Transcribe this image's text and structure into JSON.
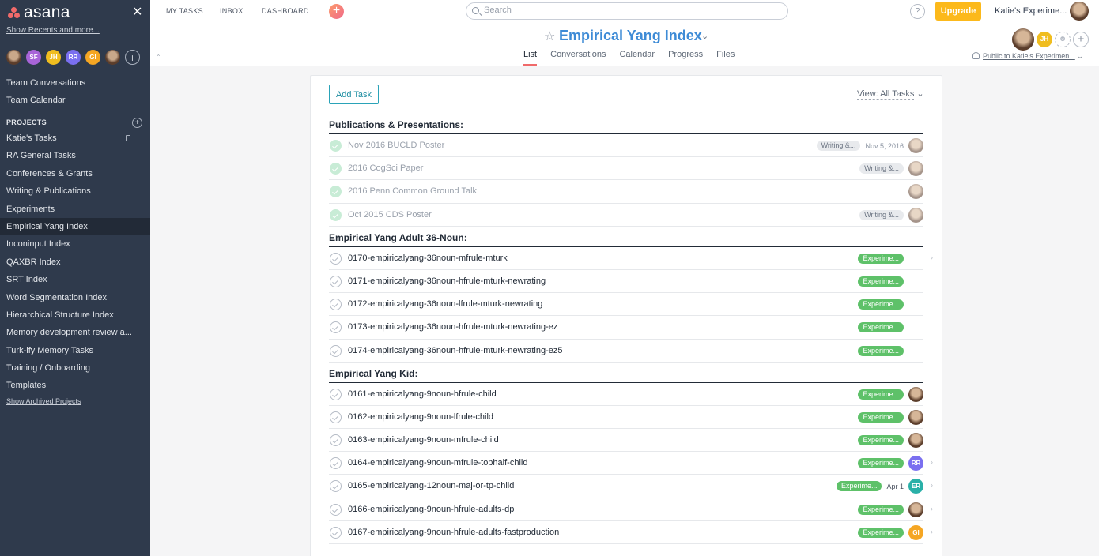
{
  "sidebar": {
    "logo": "asana",
    "close": "✕",
    "show_recents": "Show Recents and more...",
    "avatars": [
      {
        "initials": "",
        "type": "photo",
        "color": ""
      },
      {
        "initials": "SF",
        "type": "initials",
        "color": "#a864d8"
      },
      {
        "initials": "JH",
        "type": "initials",
        "color": "#f0bd1f"
      },
      {
        "initials": "RR",
        "type": "initials",
        "color": "#7a6ff0"
      },
      {
        "initials": "GI",
        "type": "initials",
        "color": "#f5a623"
      },
      {
        "initials": "",
        "type": "photo",
        "color": ""
      }
    ],
    "add_member": "+",
    "team_conversations": "Team Conversations",
    "team_calendar": "Team Calendar",
    "projects_header": "PROJECTS",
    "projects_add": "+",
    "projects": [
      {
        "label": "Katie's Tasks",
        "locked": true,
        "active": false
      },
      {
        "label": "RA General Tasks",
        "locked": false,
        "active": false
      },
      {
        "label": "Conferences & Grants",
        "locked": false,
        "active": false
      },
      {
        "label": "Writing & Publications",
        "locked": false,
        "active": false
      },
      {
        "label": "Experiments",
        "locked": false,
        "active": false
      },
      {
        "label": "Empirical Yang Index",
        "locked": false,
        "active": true
      },
      {
        "label": "Inconinput Index",
        "locked": false,
        "active": false
      },
      {
        "label": "QAXBR Index",
        "locked": false,
        "active": false
      },
      {
        "label": "SRT Index",
        "locked": false,
        "active": false
      },
      {
        "label": "Word Segmentation Index",
        "locked": false,
        "active": false
      },
      {
        "label": "Hierarchical Structure Index",
        "locked": false,
        "active": false
      },
      {
        "label": "Memory development review a...",
        "locked": false,
        "active": false
      },
      {
        "label": "Turk-ify Memory Tasks",
        "locked": false,
        "active": false
      },
      {
        "label": "Training / Onboarding",
        "locked": false,
        "active": false
      },
      {
        "label": "Templates",
        "locked": false,
        "active": false
      }
    ],
    "show_archived": "Show Archived Projects"
  },
  "topbar": {
    "my_tasks": "MY TASKS",
    "inbox": "INBOX",
    "dashboard": "DASHBOARD",
    "quick_add": "+",
    "search_placeholder": "Search",
    "help": "?",
    "upgrade": "Upgrade",
    "org": "Katie's Experime..."
  },
  "project": {
    "title": "Empirical Yang Index",
    "star": "☆",
    "chevron": "⌄",
    "collapse": "⌃",
    "tabs": [
      "List",
      "Conversations",
      "Calendar",
      "Progress",
      "Files"
    ],
    "active_tab": "List",
    "member_jh": "JH",
    "privacy": "Public to Katie's Experimen...",
    "privacy_chevron": "⌄"
  },
  "list": {
    "add_task": "Add Task",
    "view_filter": "View: All Tasks",
    "view_chevron": "⌄",
    "sections": [
      {
        "title": "Publications & Presentations:",
        "tasks": [
          {
            "name": "Nov 2016 BUCLD Poster",
            "done": true,
            "tag": "Writing &...",
            "tag_color": "gray",
            "due": "Nov 5, 2016",
            "assignee": "photo",
            "chevron": false
          },
          {
            "name": "2016 CogSci Paper",
            "done": true,
            "tag": "Writing &...",
            "tag_color": "gray",
            "due": "",
            "assignee": "photo",
            "chevron": false
          },
          {
            "name": "2016 Penn Common Ground Talk",
            "done": true,
            "tag": "",
            "tag_color": "",
            "due": "",
            "assignee": "photo",
            "chevron": false
          },
          {
            "name": "Oct 2015 CDS Poster",
            "done": true,
            "tag": "Writing &...",
            "tag_color": "gray",
            "due": "",
            "assignee": "photo",
            "chevron": false
          }
        ]
      },
      {
        "title": "Empirical Yang Adult 36-Noun:",
        "tasks": [
          {
            "name": "0170-empiricalyang-36noun-mfrule-mturk",
            "done": false,
            "tag": "Experime...",
            "tag_color": "green",
            "due": "",
            "assignee": "none",
            "chevron": true
          },
          {
            "name": "0171-empiricalyang-36noun-hfrule-mturk-newrating",
            "done": false,
            "tag": "Experime...",
            "tag_color": "green",
            "due": "",
            "assignee": "none",
            "chevron": false
          },
          {
            "name": "0172-empiricalyang-36noun-lfrule-mturk-newrating",
            "done": false,
            "tag": "Experime...",
            "tag_color": "green",
            "due": "",
            "assignee": "none",
            "chevron": false
          },
          {
            "name": "0173-empiricalyang-36noun-hfrule-mturk-newrating-ez",
            "done": false,
            "tag": "Experime...",
            "tag_color": "green",
            "due": "",
            "assignee": "none",
            "chevron": false
          },
          {
            "name": "0174-empiricalyang-36noun-hfrule-mturk-newrating-ez5",
            "done": false,
            "tag": "Experime...",
            "tag_color": "green",
            "due": "",
            "assignee": "none",
            "chevron": false
          }
        ]
      },
      {
        "title": "Empirical Yang Kid:",
        "tasks": [
          {
            "name": "0161-empiricalyang-9noun-hfrule-child",
            "done": false,
            "tag": "Experime...",
            "tag_color": "green",
            "due": "",
            "assignee": "photo",
            "chevron": false
          },
          {
            "name": "0162-empiricalyang-9noun-lfrule-child",
            "done": false,
            "tag": "Experime...",
            "tag_color": "green",
            "due": "",
            "assignee": "photo",
            "chevron": false
          },
          {
            "name": "0163-empiricalyang-9noun-mfrule-child",
            "done": false,
            "tag": "Experime...",
            "tag_color": "green",
            "due": "",
            "assignee": "photo",
            "chevron": false
          },
          {
            "name": "0164-empiricalyang-9noun-mfrule-tophalf-child",
            "done": false,
            "tag": "Experime...",
            "tag_color": "green",
            "due": "",
            "assignee": "RR",
            "chevron": true
          },
          {
            "name": "0165-empiricalyang-12noun-maj-or-tp-child",
            "done": false,
            "tag": "Experime...",
            "tag_color": "green",
            "due": "Apr 1",
            "assignee": "ER",
            "chevron": true
          },
          {
            "name": "0166-empiricalyang-9noun-hfrule-adults-dp",
            "done": false,
            "tag": "Experime...",
            "tag_color": "green",
            "due": "",
            "assignee": "photo",
            "chevron": true
          },
          {
            "name": "0167-empiricalyang-9noun-hfrule-adults-fastproduction",
            "done": false,
            "tag": "Experime...",
            "tag_color": "green",
            "due": "",
            "assignee": "GI",
            "chevron": true
          }
        ]
      }
    ]
  }
}
